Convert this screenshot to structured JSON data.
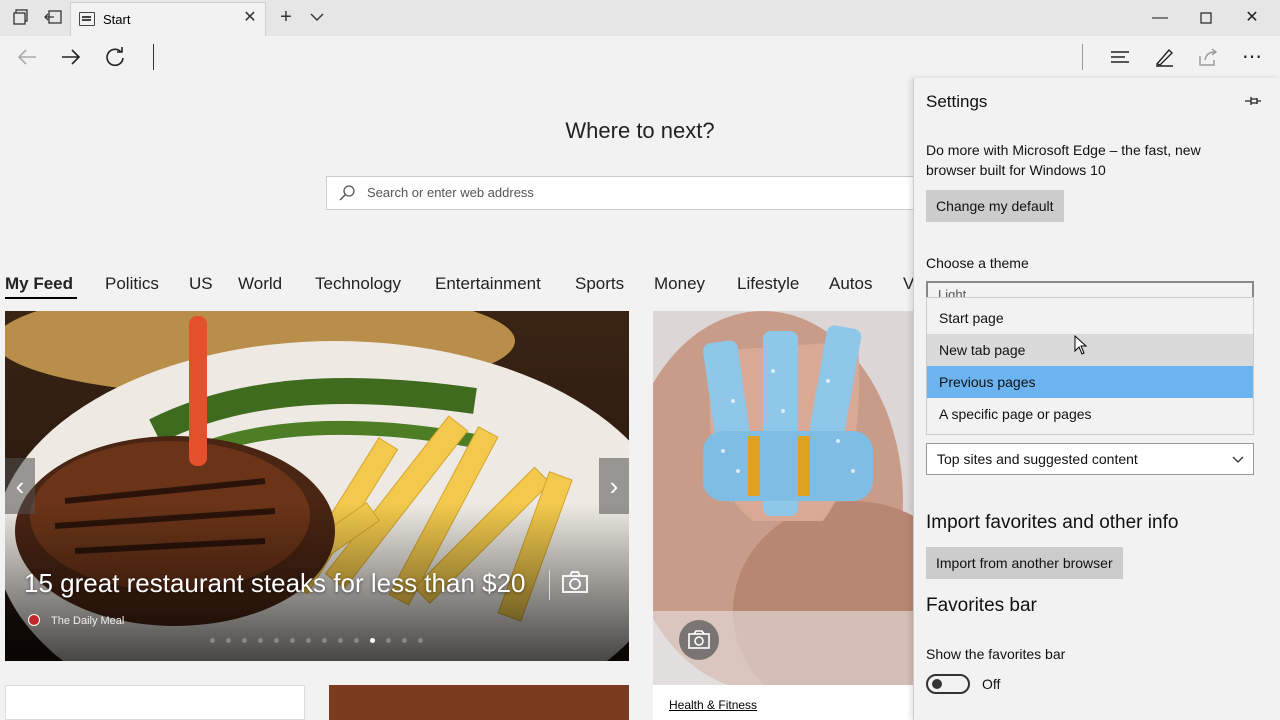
{
  "tab": {
    "title": "Start"
  },
  "page": {
    "heading": "Where to next?",
    "search_placeholder": "Search or enter web address",
    "feed_tabs": [
      "My Feed",
      "Politics",
      "US",
      "World",
      "Technology",
      "Entertainment",
      "Sports",
      "Money",
      "Lifestyle",
      "Autos",
      "V"
    ],
    "feed_active": "My Feed",
    "main_card": {
      "headline": "15 great restaurant steaks for less than $20",
      "source": "The Daily Meal",
      "carousel_total": 14,
      "carousel_active": 11
    },
    "right_card": {
      "category": "Health & Fitness"
    }
  },
  "settings": {
    "title": "Settings",
    "promo": "Do more with Microsoft Edge – the fast, new browser built for Windows 10",
    "change_default": "Change my default",
    "theme_label": "Choose a theme",
    "theme_value_peek": "Light",
    "open_with_options": [
      "Start page",
      "New tab page",
      "Previous pages",
      "A specific page or pages"
    ],
    "open_with_hovered": "New tab page",
    "open_with_selected": "Previous pages",
    "new_tab_select": "Top sites and suggested content",
    "import_heading": "Import favorites and other info",
    "import_button": "Import from another browser",
    "favorites_heading": "Favorites bar",
    "show_favorites_label": "Show the favorites bar",
    "show_favorites_state": "Off"
  },
  "colors": {
    "selected_item": "#6cb4ef",
    "panel_bg": "#f2f2f2"
  }
}
